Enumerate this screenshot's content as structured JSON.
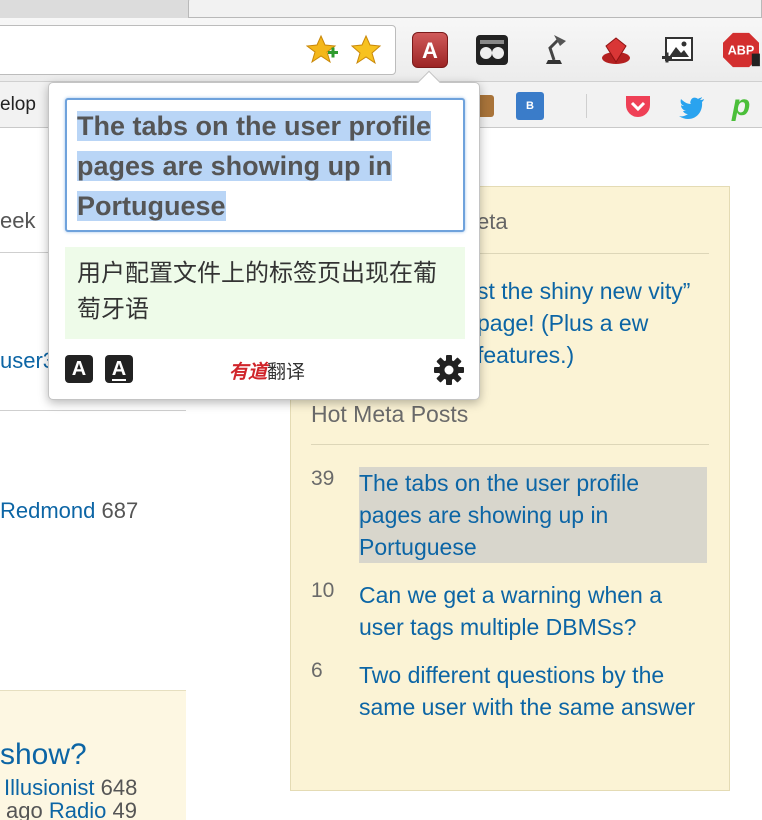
{
  "browser": {
    "bookmark_partial_label": "elop",
    "bookmark_blue_label": "B"
  },
  "page": {
    "left": {
      "week_label": "eek",
      "user3_label": "user3",
      "redmond_name": "Redmond",
      "redmond_rep": "687",
      "illusionist_name": "Illusionist",
      "illusionist_rep": "648",
      "question_tail": "show?",
      "ago_label": "ago",
      "radio_name": "Radio",
      "radio_rep": "49"
    },
    "meta_box": {
      "section_title_partial": "eta",
      "blog_post_partial": "st the shiny new vity” page! (Plus a ew features.)",
      "hot_title": "Hot Meta Posts",
      "posts": [
        {
          "score": "39",
          "title": "The tabs on the user profile pages are showing up in Portuguese"
        },
        {
          "score": "10",
          "title": "Can we get a warning when a user tags multiple DBMSs?"
        },
        {
          "score": "6",
          "title": "Two different questions by the same user with the same answer"
        }
      ]
    }
  },
  "popup": {
    "source_text": "The tabs on the user profile pages are showing up in Portuguese",
    "translation": "用户配置文件上的标签页出现在葡萄牙语",
    "font_smaller_label": "A",
    "font_larger_label": "A",
    "brand_youdao": "有道",
    "brand_fanyi": "翻译",
    "icons": [
      "font-size-icon",
      "font-size-underline-icon",
      "gear-icon"
    ]
  },
  "colors": {
    "link": "#0c65a5",
    "selection": "#b9d5f6",
    "translation_bg": "#eefbe9",
    "meta_box_bg": "#fbf3d5",
    "brand_red": "#d0252b"
  }
}
